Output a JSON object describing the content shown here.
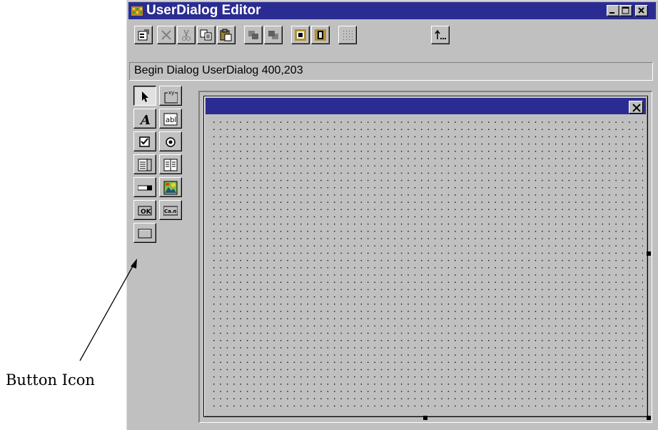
{
  "window": {
    "title": "UserDialog Editor",
    "icons": {
      "app": "grid-app-icon",
      "minimize": "minimize-icon",
      "maximize": "maximize-icon",
      "close": "close-icon"
    }
  },
  "toolbar": {
    "buttons": [
      {
        "name": "dialog-properties-button",
        "icon": "properties-icon",
        "enabled": true
      },
      {
        "name": "delete-button",
        "icon": "delete-x-icon",
        "enabled": false
      },
      {
        "name": "cut-button",
        "icon": "scissors-icon",
        "enabled": false
      },
      {
        "name": "copy-button",
        "icon": "copy-icon",
        "enabled": true
      },
      {
        "name": "paste-button",
        "icon": "paste-icon",
        "enabled": true
      },
      {
        "name": "bring-to-front-button",
        "icon": "bring-to-front-icon",
        "enabled": false
      },
      {
        "name": "send-to-back-button",
        "icon": "send-to-back-icon",
        "enabled": false
      },
      {
        "name": "same-size-button",
        "icon": "same-size-icon",
        "enabled": true
      },
      {
        "name": "align-button",
        "icon": "align-icon",
        "enabled": true
      },
      {
        "name": "grid-button",
        "icon": "grid-icon",
        "enabled": true
      },
      {
        "name": "return-button",
        "icon": "return-icon",
        "enabled": true
      }
    ]
  },
  "statement": {
    "text": "Begin Dialog UserDialog 400,203"
  },
  "toolbox": {
    "tools": [
      {
        "name": "select-tool",
        "icon": "arrow-pointer-icon",
        "pressed": true
      },
      {
        "name": "groupbox-tool",
        "icon": "groupbox-icon",
        "label": "xy"
      },
      {
        "name": "text-tool",
        "icon": "text-a-icon",
        "label": "A"
      },
      {
        "name": "textbox-tool",
        "icon": "textbox-icon",
        "label": "abl"
      },
      {
        "name": "checkbox-tool",
        "icon": "checkbox-icon"
      },
      {
        "name": "optionbutton-tool",
        "icon": "radio-icon"
      },
      {
        "name": "listbox-tool",
        "icon": "listbox-icon"
      },
      {
        "name": "combobox-tool",
        "icon": "dropdown-list-icon"
      },
      {
        "name": "dropdown-tool",
        "icon": "dropdown-combo-icon"
      },
      {
        "name": "picture-tool",
        "icon": "picture-icon"
      },
      {
        "name": "okbutton-tool",
        "icon": "ok-button-icon",
        "label": "OK"
      },
      {
        "name": "cancelbutton-tool",
        "icon": "cancel-button-icon",
        "label": "Ca.n"
      },
      {
        "name": "pushbutton-tool",
        "icon": "push-button-icon"
      }
    ]
  },
  "dialog": {
    "close_icon": "close-icon"
  },
  "callout": {
    "label": "Button Icon"
  },
  "colors": {
    "titlebar": "#2b2c92",
    "face": "#c0c0c0"
  }
}
